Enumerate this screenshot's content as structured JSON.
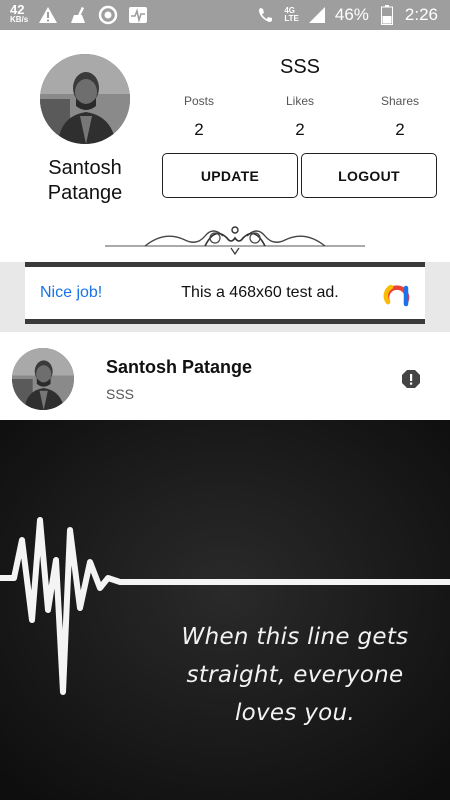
{
  "status_bar": {
    "speed_value": "42",
    "speed_unit": "KB/s",
    "network_top": "4G",
    "network_bottom": "LTE",
    "battery": "46%",
    "time": "2:26",
    "icons": [
      "warning-icon",
      "cleaner-icon",
      "circle-app-icon",
      "pulse-app-icon",
      "wifi-call-icon",
      "signal-icon",
      "battery-icon"
    ]
  },
  "profile": {
    "name_line1": "Santosh",
    "name_line2": "Patange",
    "handle": "SSS",
    "stats": [
      {
        "label": "Posts",
        "value": "2"
      },
      {
        "label": "Likes",
        "value": "2"
      },
      {
        "label": "Shares",
        "value": "2"
      }
    ],
    "update_label": "UPDATE",
    "logout_label": "LOGOUT"
  },
  "ad": {
    "badge": "Nice job!",
    "text": "This a 468x60 test ad.",
    "colors": {
      "blue": "#1a73e8",
      "red": "#ea4335",
      "yellow": "#fbbc04"
    }
  },
  "post": {
    "author": "Santosh Patange",
    "subtitle": "SSS",
    "quote_line1": "When this line gets",
    "quote_line2": "straight, everyone",
    "quote_line3": "loves you."
  }
}
